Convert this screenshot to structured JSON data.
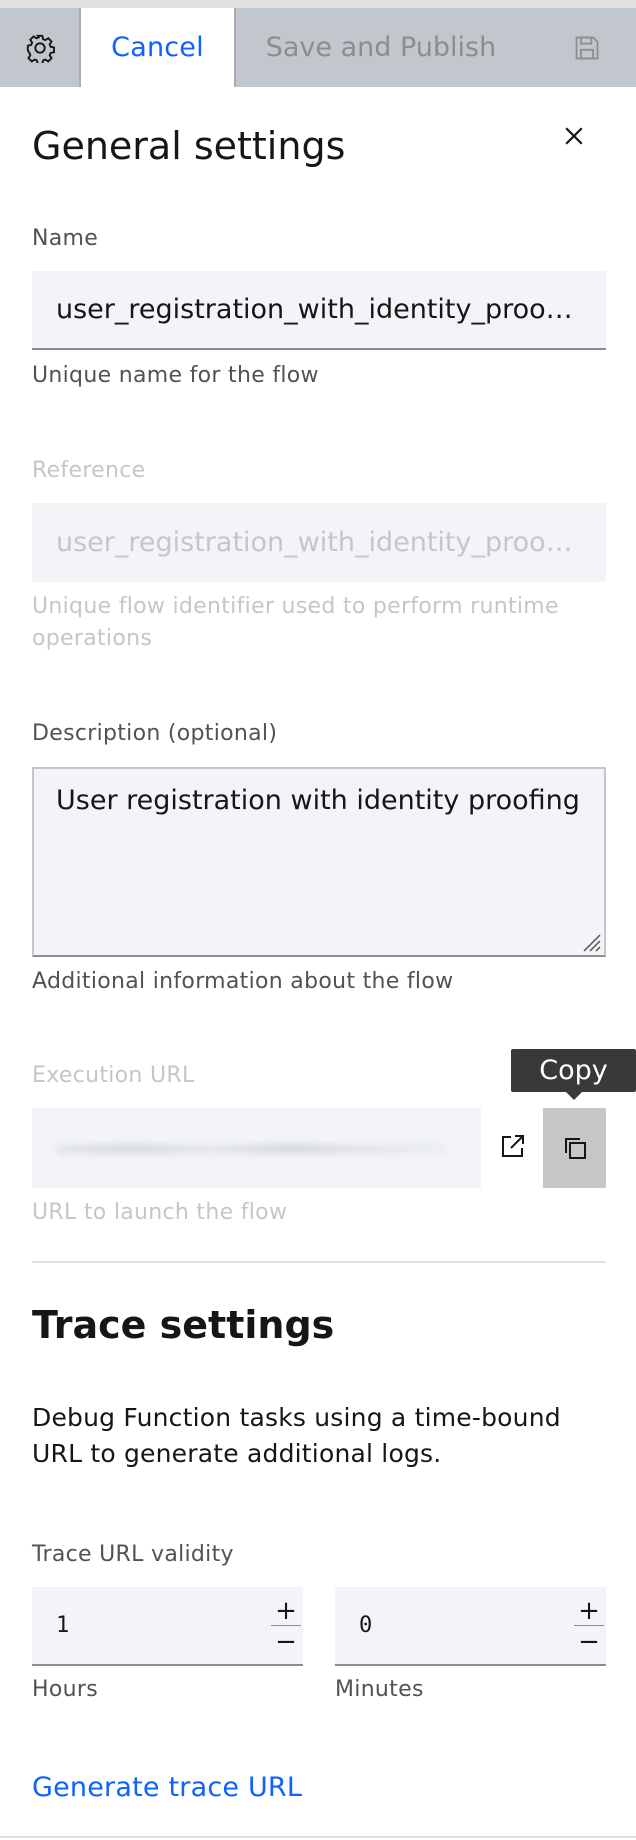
{
  "toolbar": {
    "settings_icon": "gear-icon",
    "cancel_label": "Cancel",
    "publish_label": "Save and Publish",
    "save_icon": "save-icon"
  },
  "general": {
    "title": "General settings",
    "close_icon": "close-icon",
    "name": {
      "label": "Name",
      "value": "user_registration_with_identity_proofing",
      "helper": "Unique name for the flow"
    },
    "reference": {
      "label": "Reference",
      "value": "user_registration_with_identity_proofing",
      "helper": "Unique flow identifier used to perform runtime operations"
    },
    "description": {
      "label": "Description (optional)",
      "value": "User registration with identity proofing",
      "helper": "Additional information about the flow"
    },
    "execution_url": {
      "label": "Execution URL",
      "helper": "URL to launch the flow",
      "tooltip": "Copy",
      "launch_icon": "launch-icon",
      "copy_icon": "copy-icon"
    }
  },
  "trace": {
    "title": "Trace settings",
    "description": "Debug Function tasks using a time-bound URL to generate additional logs.",
    "validity_label": "Trace URL validity",
    "hours": {
      "value": "1",
      "label": "Hours"
    },
    "minutes": {
      "value": "0",
      "label": "Minutes"
    },
    "plus": "+",
    "minus": "−",
    "generate_label": "Generate trace URL"
  },
  "colors": {
    "accent": "#0f62fe",
    "toolbar_bg": "#c1c7cd",
    "field_bg": "#f2f4f8",
    "tooltip_bg": "#393939"
  }
}
